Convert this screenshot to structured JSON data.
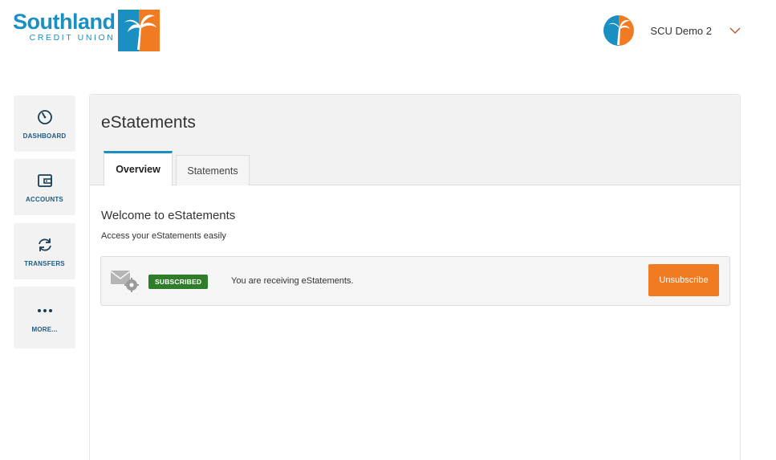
{
  "brand": {
    "name": "Southland",
    "sub": "CREDIT UNION",
    "primary_color": "#1a8fc2",
    "accent_color": "#f07b23"
  },
  "user": {
    "name": "SCU Demo 2",
    "menu_icon": "chevron-down-icon"
  },
  "sidebar": {
    "items": [
      {
        "label": "DASHBOARD",
        "icon": "gauge-icon"
      },
      {
        "label": "ACCOUNTS",
        "icon": "wallet-icon"
      },
      {
        "label": "TRANSFERS",
        "icon": "transfer-arrows-icon"
      },
      {
        "label": "MORE...",
        "icon": "more-dots-icon"
      }
    ]
  },
  "page": {
    "title": "eStatements",
    "tabs": [
      {
        "label": "Overview",
        "active": true
      },
      {
        "label": "Statements",
        "active": false
      }
    ],
    "welcome": "Welcome to eStatements",
    "subtitle": "Access your eStatements easily"
  },
  "subscription": {
    "icon": "mail-settings-icon",
    "status": "SUBSCRIBED",
    "status_color": "#2f7d2b",
    "message": "You are receiving eStatements.",
    "button_label": "Unsubscribe"
  }
}
